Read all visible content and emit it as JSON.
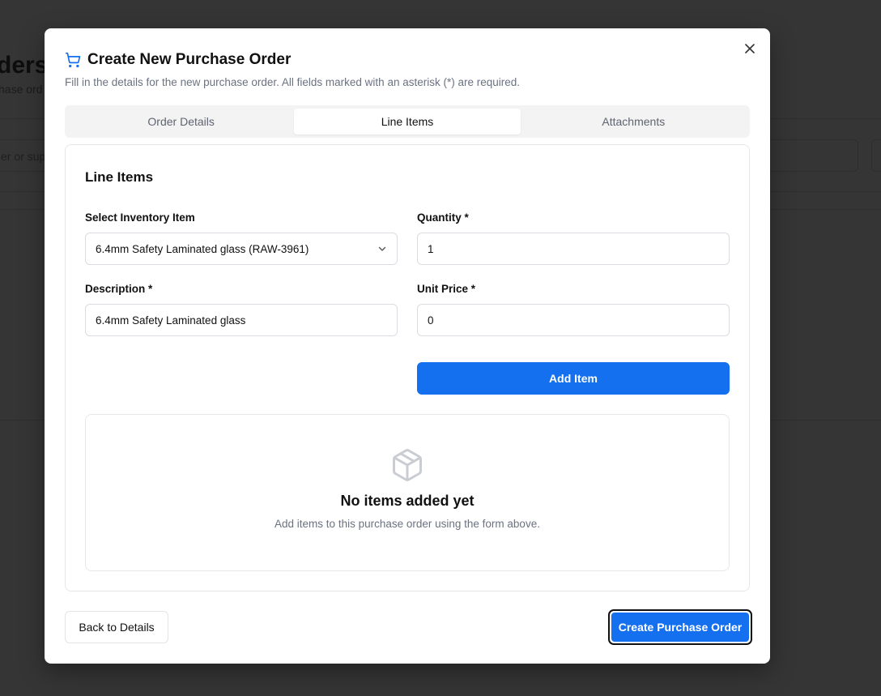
{
  "background": {
    "page_title": "ders",
    "page_subtitle": "hase ord",
    "search_placeholder": "er or sup"
  },
  "modal": {
    "title": "Create New Purchase Order",
    "description": "Fill in the details for the new purchase order. All fields marked with an asterisk (*) are required.",
    "tabs": [
      {
        "label": "Order Details",
        "active": false
      },
      {
        "label": "Line Items",
        "active": true
      },
      {
        "label": "Attachments",
        "active": false
      }
    ],
    "line_items": {
      "heading": "Line Items",
      "inventory_label": "Select Inventory Item",
      "inventory_value": "6.4mm Safety Laminated glass (RAW-3961)",
      "quantity_label": "Quantity *",
      "quantity_value": "1",
      "description_label": "Description *",
      "description_value": "6.4mm Safety Laminated glass",
      "unit_price_label": "Unit Price *",
      "unit_price_value": "0",
      "add_button": "Add Item",
      "empty_title": "No items added yet",
      "empty_description": "Add items to this purchase order using the form above."
    },
    "footer": {
      "back_button": "Back to Details",
      "create_button": "Create Purchase Order"
    }
  },
  "colors": {
    "accent": "#1570ef",
    "overlay": "#353535",
    "muted_text": "#6b7280"
  },
  "icons": {
    "title": "shopping-cart-icon",
    "close": "close-icon",
    "select": "chevron-down-icon",
    "empty_state": "package-icon"
  }
}
